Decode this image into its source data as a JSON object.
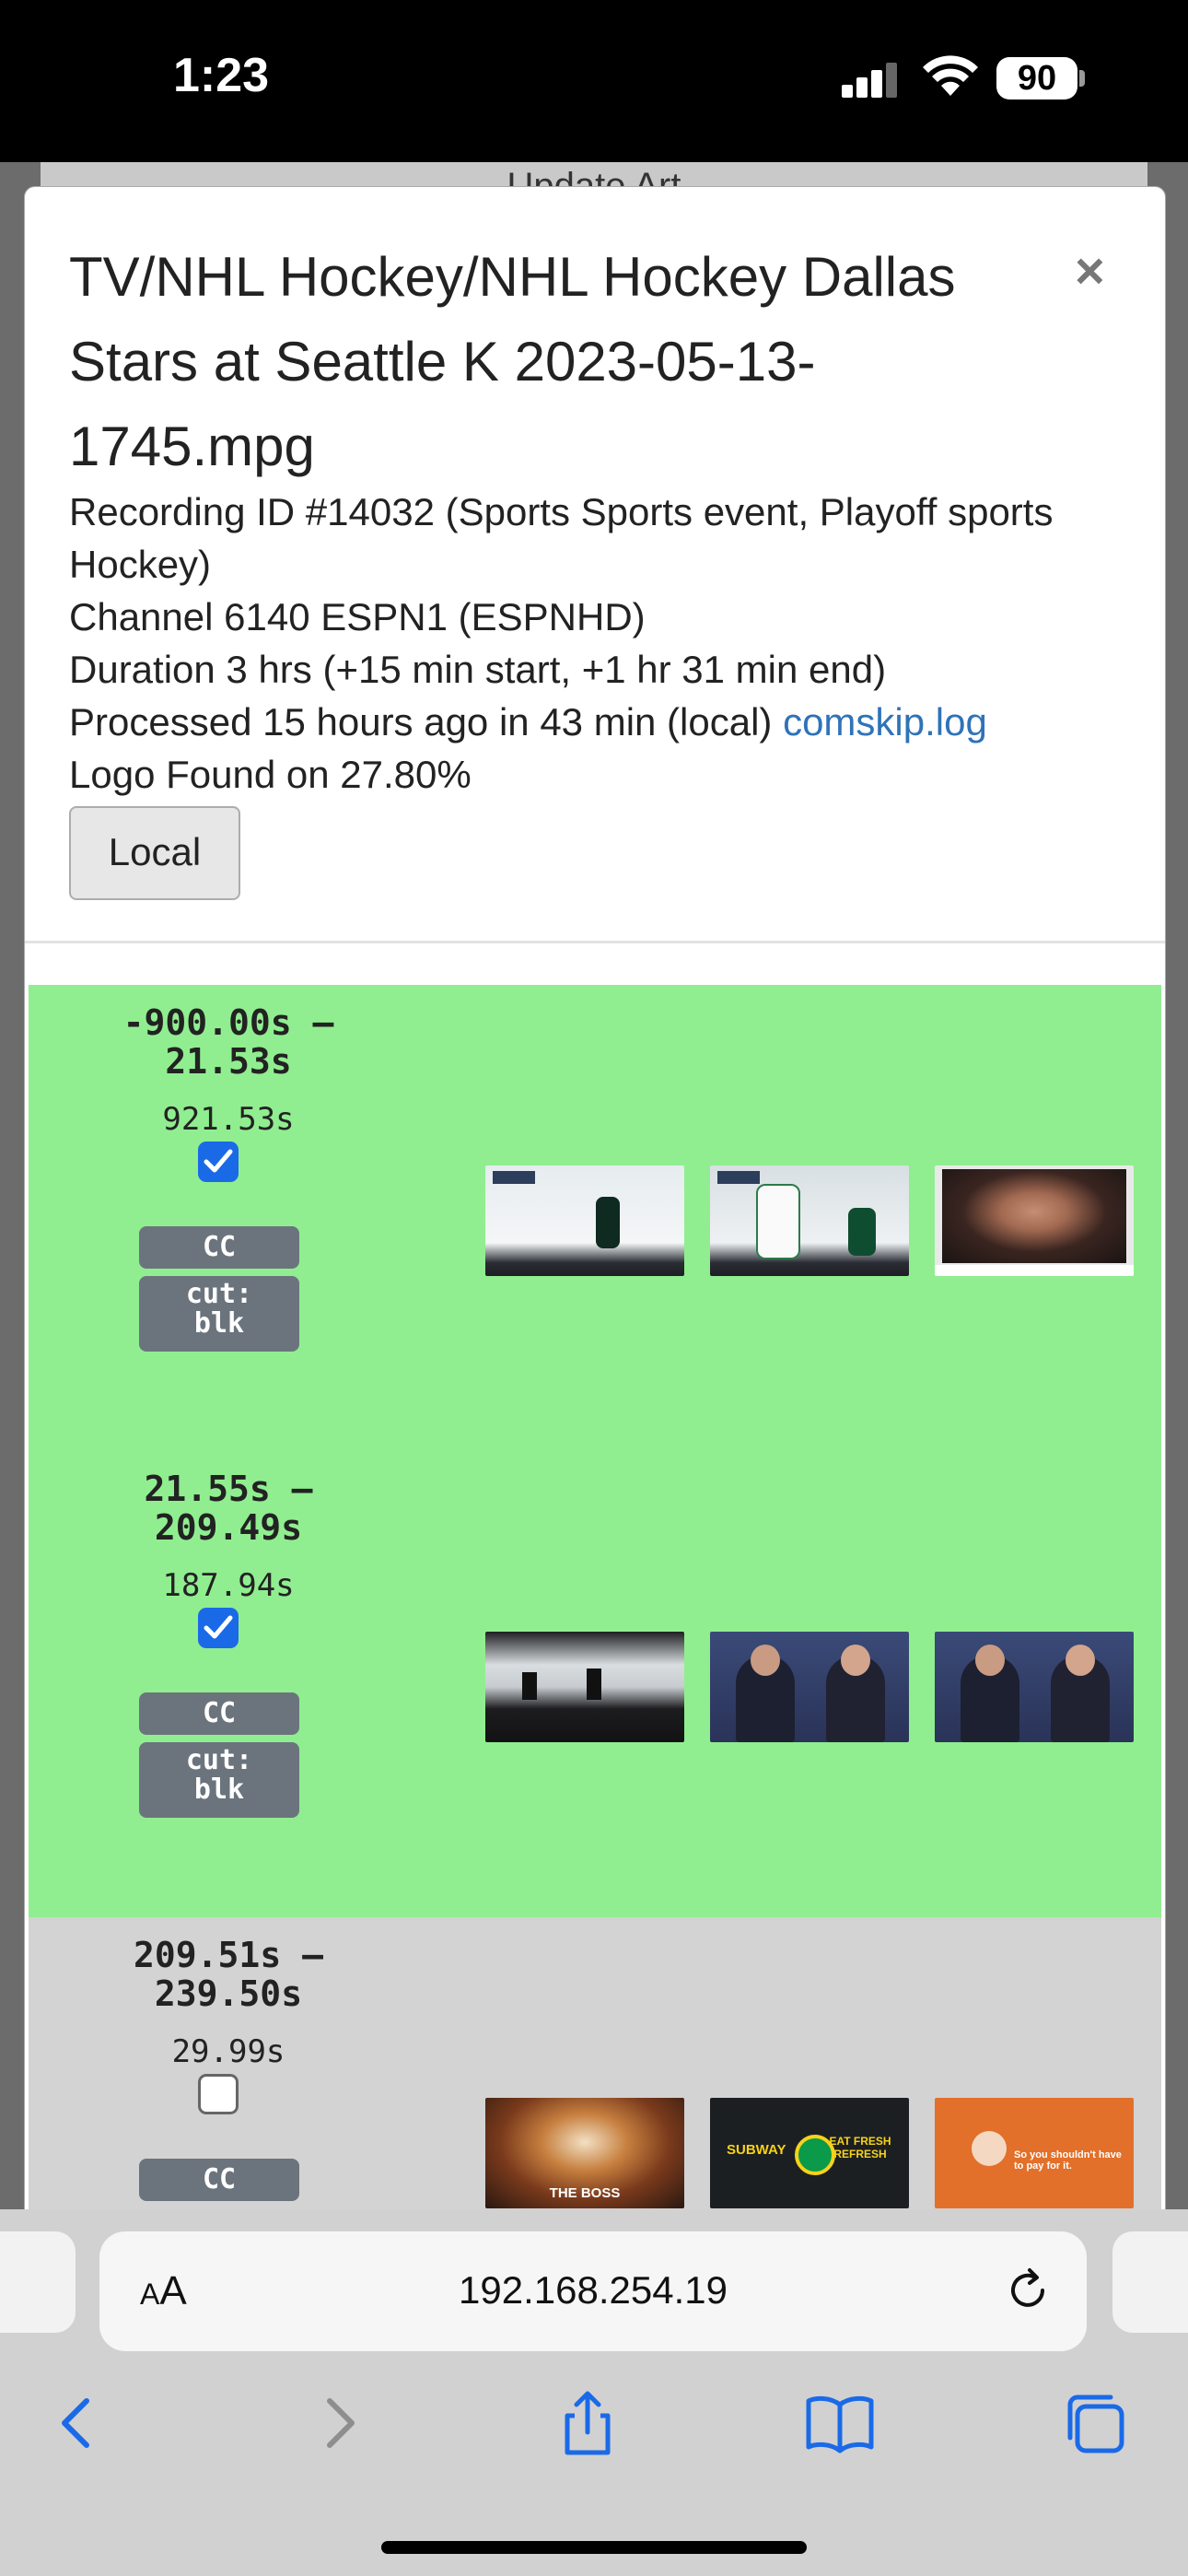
{
  "status_bar": {
    "time": "1:23",
    "battery": "90"
  },
  "backdrop": {
    "text": "Update Art"
  },
  "modal": {
    "title": "TV/NHL Hockey/NHL Hockey Dallas Stars at Seattle K 2023-05-13-1745.mpg",
    "close_label": "×",
    "recording_line": "Recording ID #14032 (Sports Sports event, Playoff sports Hockey)",
    "channel_line": "Channel 6140 ESPN1 (ESPNHD)",
    "duration_line": "Duration 3 hrs (+15 min start, +1 hr 31 min end)",
    "processed_line": "Processed 15 hours ago in 43 min (local)",
    "processed_link": "comskip.log",
    "logo_line": "Logo Found on 27.80%",
    "local_button": "Local"
  },
  "segments": [
    {
      "time_range_1": "-900.00s –",
      "time_range_2": "21.53s",
      "duration": "921.53s",
      "checked": true,
      "badges": [
        "CC",
        "cut:\nblk"
      ],
      "background": "#90ee90",
      "thumbnails": [
        {
          "icon": "hockey-ice-thumb",
          "color": "#e9eef1"
        },
        {
          "icon": "hockey-player-thumb",
          "color": "#dfe6ea"
        },
        {
          "icon": "woman-speaking-thumb",
          "color": "#3a2a24"
        }
      ]
    },
    {
      "time_range_1": "21.55s –",
      "time_range_2": "209.49s",
      "duration": "187.94s",
      "checked": true,
      "badges": [
        "CC",
        "cut:\nblk"
      ],
      "background": "#90ee90",
      "thumbnails": [
        {
          "icon": "crowd-thumb",
          "color": "#1d1d1f"
        },
        {
          "icon": "studio-hosts-thumb",
          "color": "#2b3556"
        },
        {
          "icon": "studio-hosts-thumb",
          "color": "#2b3556"
        }
      ]
    },
    {
      "time_range_1": "209.51s –",
      "time_range_2": "239.50s",
      "duration": "29.99s",
      "checked": false,
      "badges": [
        "CC"
      ],
      "background": "#d3d3d3",
      "thumbnails": [
        {
          "icon": "sandwich-ad-thumb",
          "color": "#6b3b22",
          "label": "THE BOSS"
        },
        {
          "icon": "subway-ad-thumb",
          "color": "#1c1f22",
          "label": "EAT FRESH REFRESH"
        },
        {
          "icon": "orange-ad-thumb",
          "color": "#e2702a",
          "label": "So you shouldn't have to pay for it."
        }
      ]
    }
  ],
  "browser": {
    "url": "192.168.254.19",
    "aa_label": "AA"
  }
}
